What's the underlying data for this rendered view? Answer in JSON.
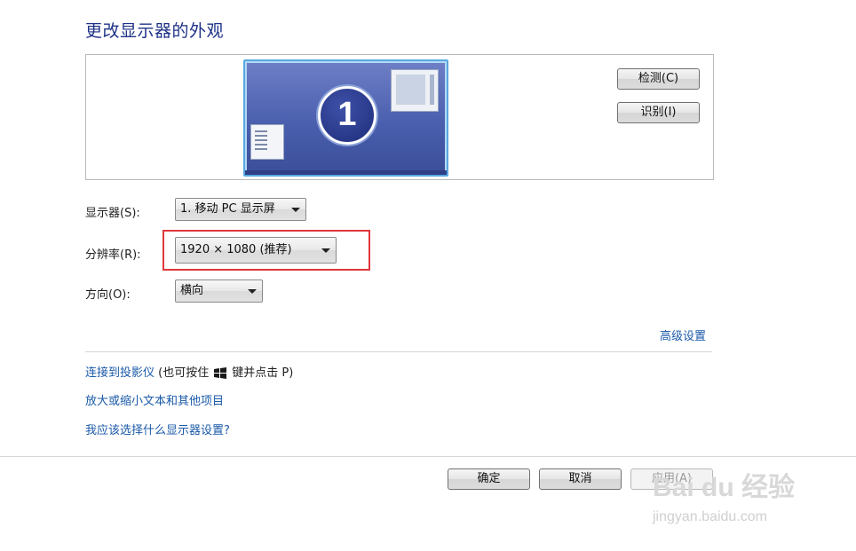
{
  "page_title": "更改显示器的外观",
  "preview": {
    "monitor_number": "1",
    "detect_button": "检测(C)",
    "identify_button": "识别(I)"
  },
  "fields": {
    "display_label": "显示器(S):",
    "display_value": "1. 移动 PC 显示屏",
    "resolution_label": "分辨率(R):",
    "resolution_value": "1920 × 1080 (推荐)",
    "orientation_label": "方向(O):",
    "orientation_value": "横向"
  },
  "links": {
    "advanced": "高级设置",
    "projector_link": "连接到投影仪",
    "projector_tail_before": "(也可按住",
    "projector_tail_after": "键并点击 P)",
    "text_size": "放大或缩小文本和其他项目",
    "which_settings": "我应该选择什么显示器设置?"
  },
  "footer": {
    "ok": "确定",
    "cancel": "取消",
    "apply": "应用(A)"
  },
  "watermark": {
    "main": "Bai du 经验",
    "sub": "jingyan.baidu.com"
  },
  "colors": {
    "title": "#1e3287",
    "link": "#1b5aa8",
    "highlight": "#e0373b"
  }
}
